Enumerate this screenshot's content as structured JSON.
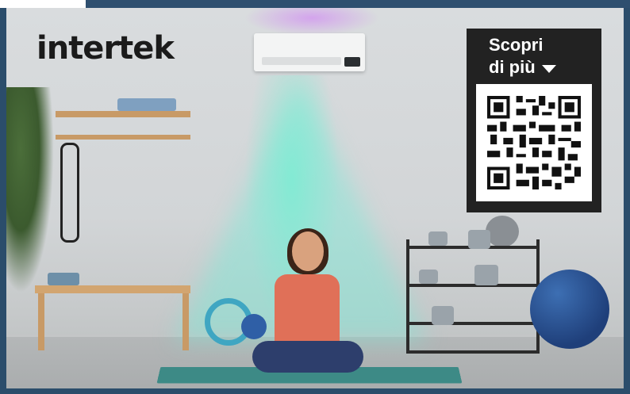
{
  "brand": {
    "logo_text": "intertek"
  },
  "qr_card": {
    "line1": "Scopri",
    "line2": "di più"
  },
  "colors": {
    "page_bg": "#2b4d6b",
    "beam": "#78ebd7",
    "qr_bg": "#222222",
    "qr_fg": "#111111"
  },
  "icons": {
    "arrow": "caret-down-icon",
    "qr": "qr-code-icon"
  }
}
